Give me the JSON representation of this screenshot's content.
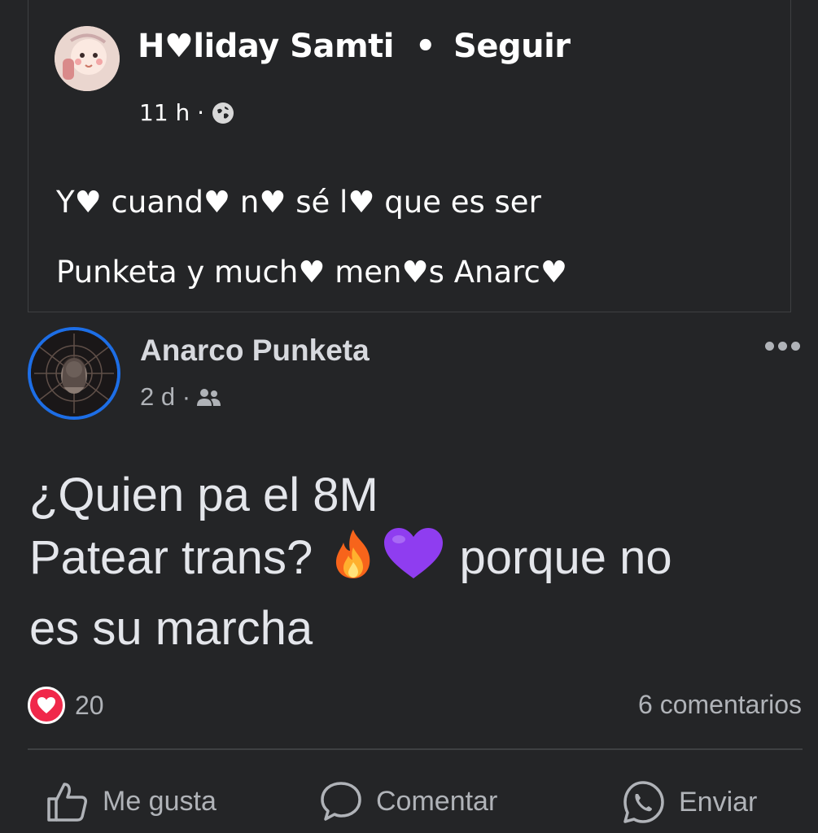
{
  "shared_post": {
    "author": "H♥liday Samti",
    "separator": "•",
    "follow_label": "Seguir",
    "time": "11 h ·",
    "privacy_icon": "globe-icon",
    "text_line1": "Y♥ cuand♥ n♥ sé l♥ que es ser",
    "text_line2": "Punketa y much♥ men♥s Anarc♥"
  },
  "post": {
    "author": "Anarco Punketa",
    "time": "2 d ·",
    "privacy_icon": "friends-icon",
    "text_line1": "¿Quien pa el 8M",
    "text_line2_pre": "Patear trans?",
    "text_line2_post": "porque no",
    "text_line3": "es su marcha",
    "emojis": [
      "fire-emoji",
      "purple-heart-emoji"
    ]
  },
  "reactions": {
    "icon": "love-icon",
    "count": "20",
    "comments": "6 comentarios"
  },
  "actions": {
    "like": "Me gusta",
    "comment": "Comentar",
    "share": "Enviar"
  },
  "colors": {
    "background": "#242527",
    "avatar_ring": "#1d6ee6",
    "love": "#f0284a",
    "secondary_text": "#b0b3b8"
  }
}
